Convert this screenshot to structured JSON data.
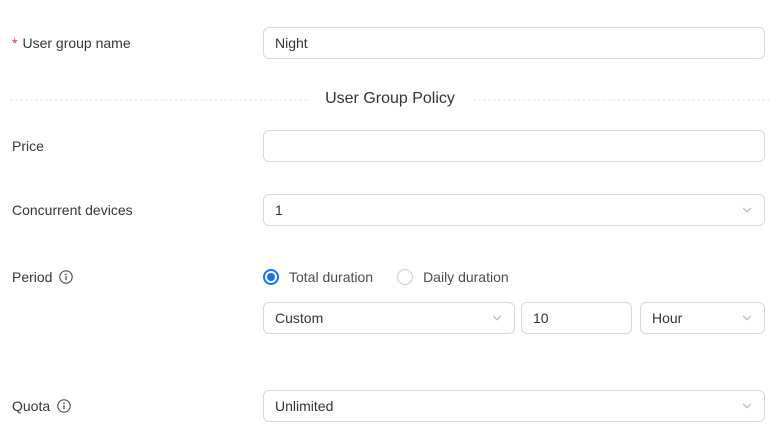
{
  "colors": {
    "accent_blue": "#1774f0",
    "required_red": "#e0323f",
    "border_gray": "#d9d9d9",
    "divider_gray": "#e4e4e8"
  },
  "form": {
    "user_group_name": {
      "required_mark": "*",
      "label": "User group name",
      "value": "Night"
    },
    "section_divider": {
      "title": "User Group Policy"
    },
    "price": {
      "label": "Price",
      "value": ""
    },
    "concurrent_devices": {
      "label": "Concurrent devices",
      "value": "1"
    },
    "period": {
      "label": "Period",
      "radio_options": [
        {
          "label": "Total duration",
          "selected": true
        },
        {
          "label": "Daily duration",
          "selected": false
        }
      ],
      "duration_type": {
        "value": "Custom"
      },
      "duration_value": {
        "value": "10"
      },
      "duration_unit": {
        "value": "Hour"
      }
    },
    "quota": {
      "label": "Quota",
      "value": "Unlimited"
    }
  }
}
